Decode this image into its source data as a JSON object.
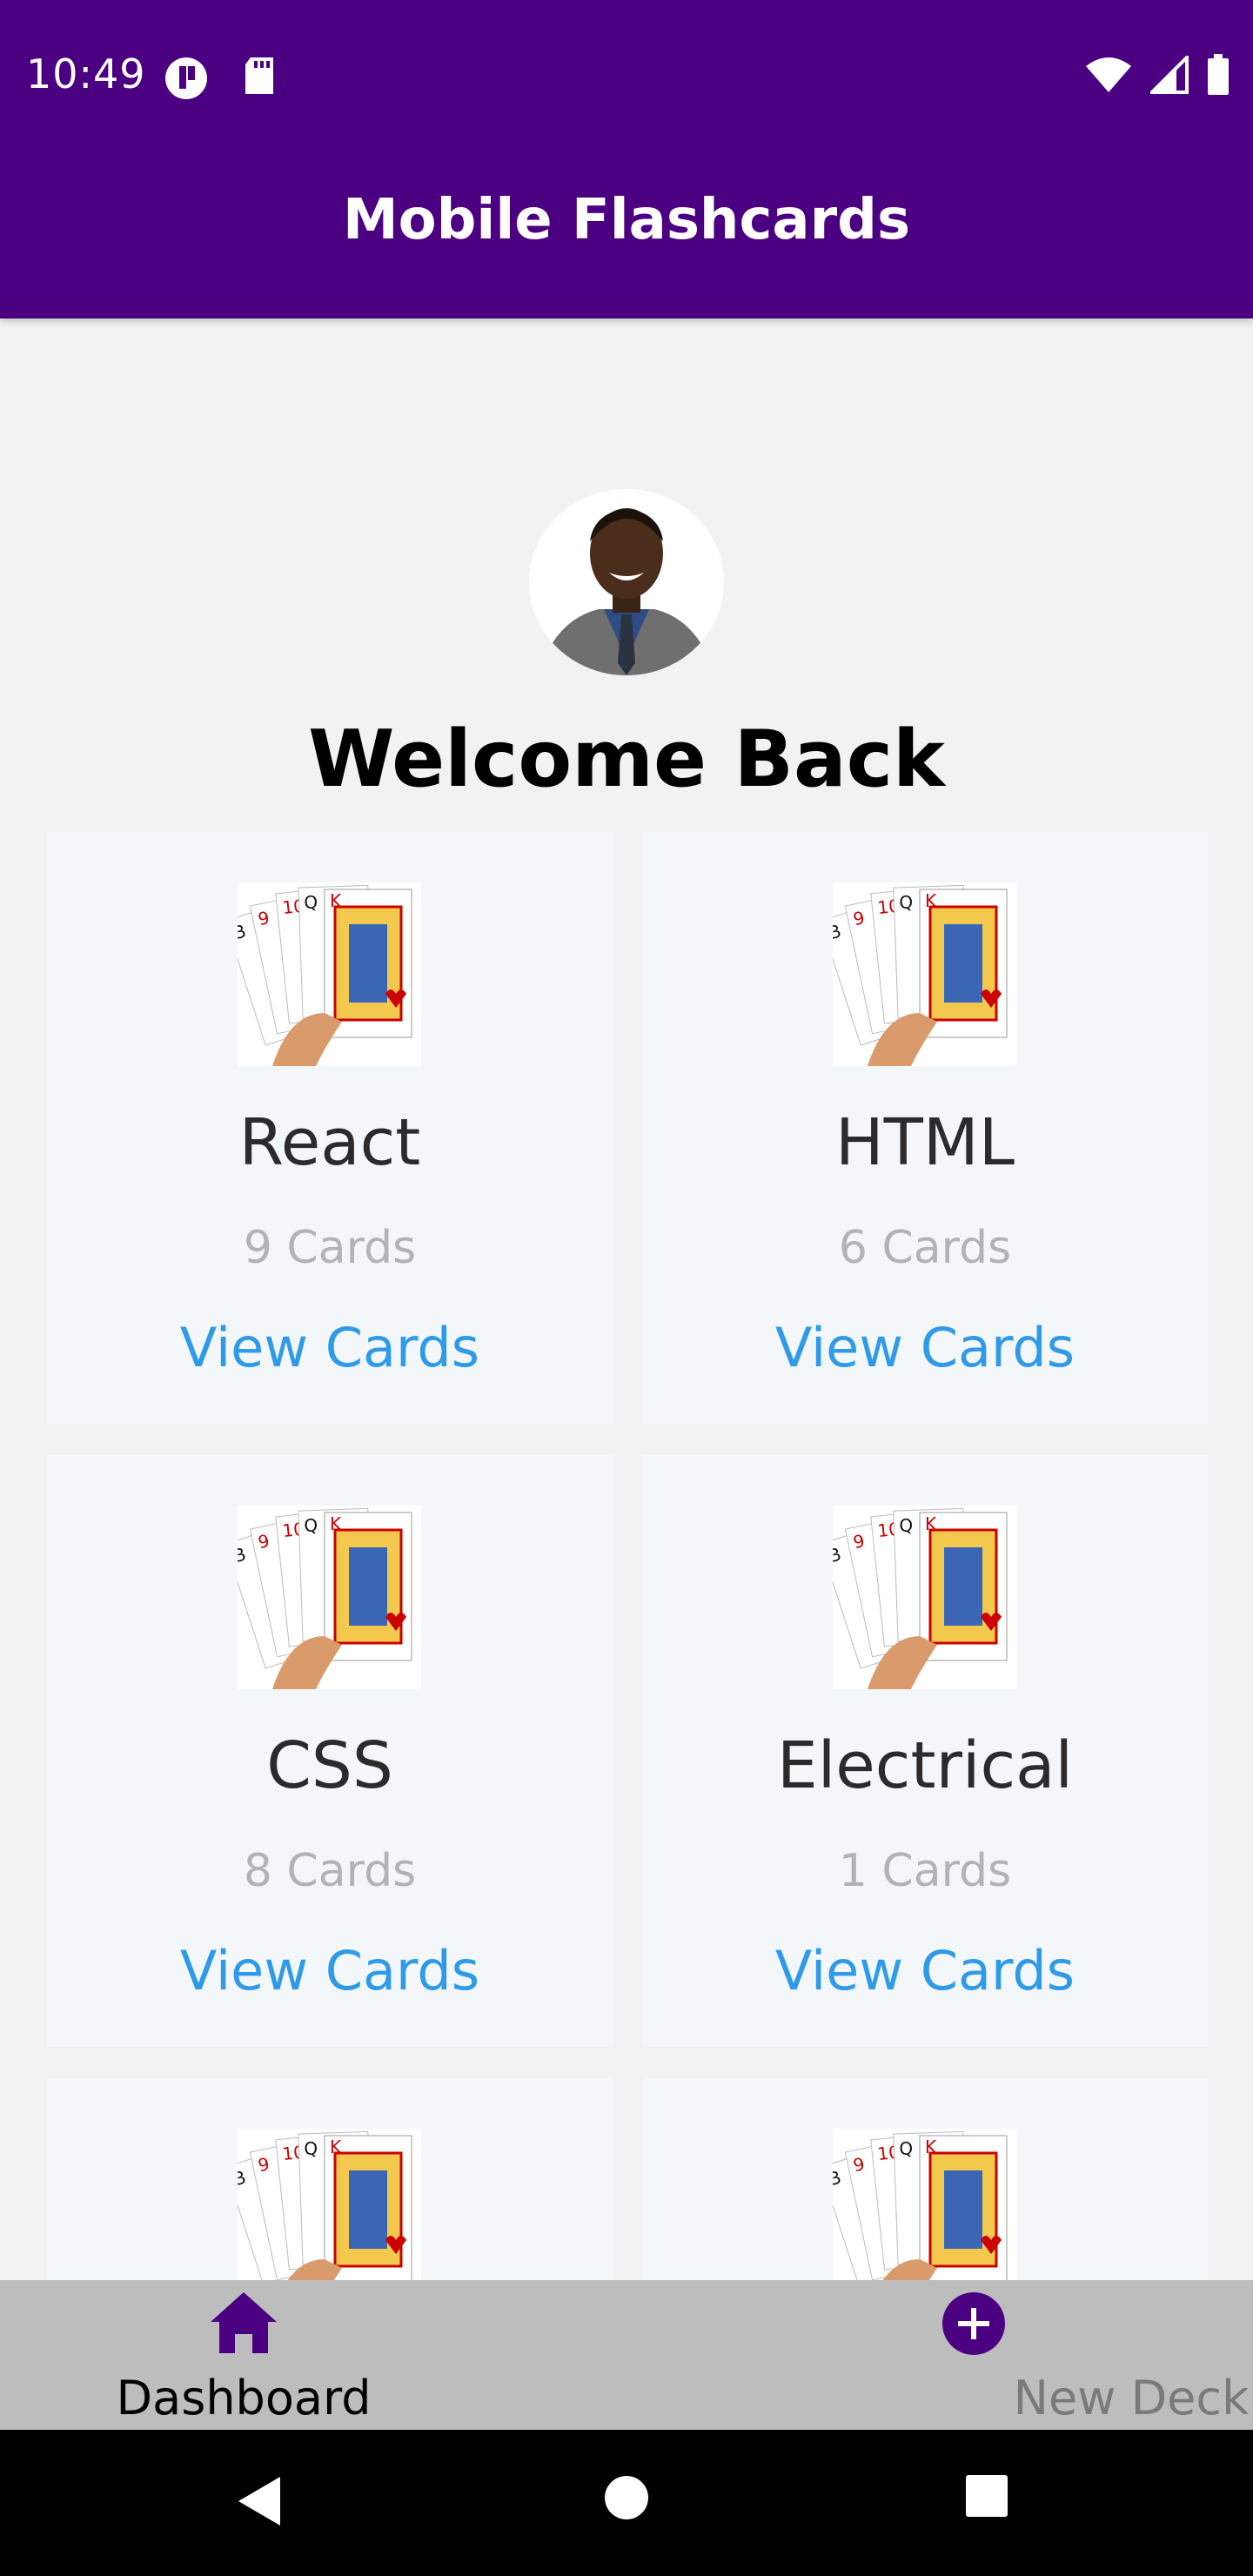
{
  "status_bar": {
    "time": "10:49",
    "icons": [
      "tile-app-icon",
      "sd-card-icon",
      "wifi-icon",
      "signal-icon",
      "battery-icon"
    ]
  },
  "app_bar": {
    "title": "Mobile Flashcards"
  },
  "profile": {
    "avatar": "profile-photo",
    "welcome": "Welcome Back"
  },
  "decks": [
    {
      "title": "React",
      "count": "9 Cards",
      "link": "View Cards"
    },
    {
      "title": "HTML",
      "count": "6 Cards",
      "link": "View Cards"
    },
    {
      "title": "CSS",
      "count": "8 Cards",
      "link": "View Cards"
    },
    {
      "title": "Electrical",
      "count": "1 Cards",
      "link": "View Cards"
    },
    {
      "title": "",
      "count": "",
      "link": ""
    },
    {
      "title": "",
      "count": "",
      "link": ""
    }
  ],
  "bottom_nav": {
    "items": [
      {
        "label": "Dashboard",
        "icon": "home-icon",
        "active": true
      },
      {
        "label": "New Deck",
        "icon": "plus-circle-icon",
        "active": false
      }
    ]
  },
  "colors": {
    "primary": "#4b0082",
    "link": "#2f9be8",
    "muted": "#b3b3b3",
    "card_bg": "#f4f7fa",
    "nav_bg": "#bdbdbd"
  }
}
